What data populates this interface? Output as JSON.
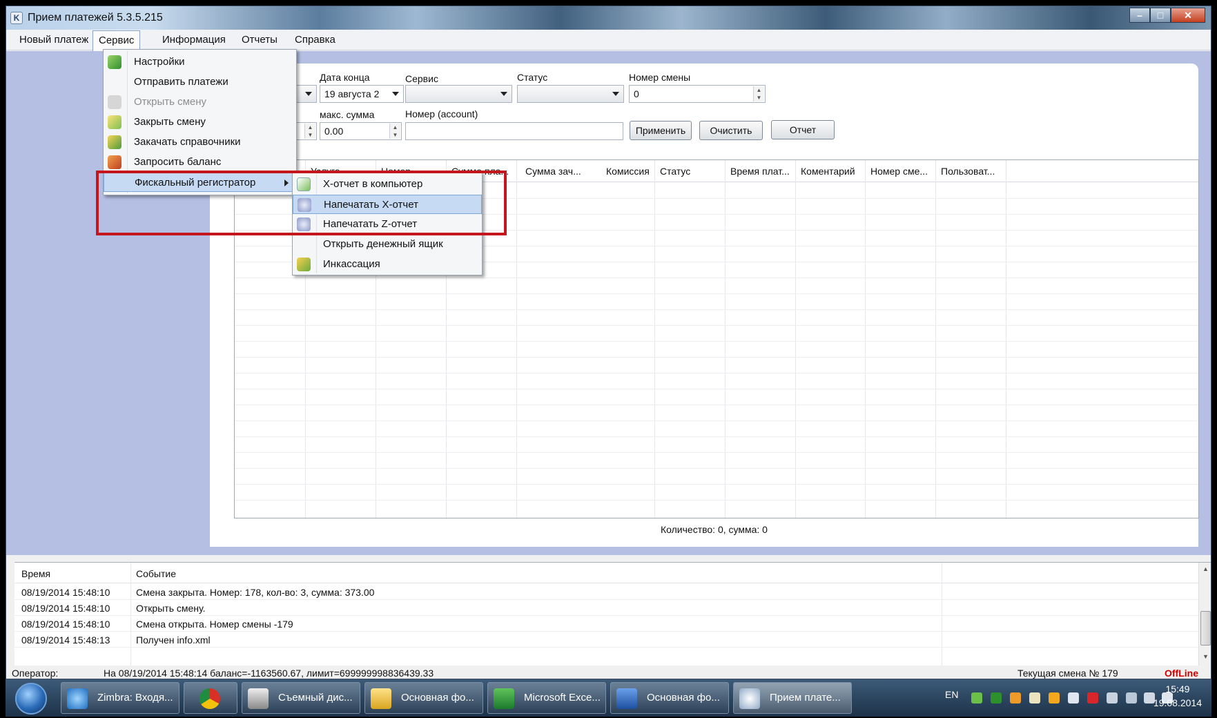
{
  "window": {
    "title": "Прием платежей 5.3.5.215",
    "controls": [
      "–",
      "□",
      "✕"
    ]
  },
  "menubar": [
    "Новый платеж",
    "Сервис",
    "Информация",
    "Отчеты",
    "Справка"
  ],
  "filters": {
    "date_end_label": "Дата конца",
    "date_end_value": "19  августа  2",
    "service_label": "Сервис",
    "status_label": "Статус",
    "shift_no_label": "Номер смены",
    "shift_no_value": "0",
    "max_sum_label": "макс. сумма",
    "max_sum_value": "0.00",
    "account_label": "Номер (account)",
    "apply_button": "Применить",
    "clear_button": "Очистить",
    "report_button": "Отчет"
  },
  "grid": {
    "columns": [
      "Услуга",
      "Номер",
      "Сумма пла...",
      "Сумма зач...",
      "Комиссия",
      "Статус",
      "Время плат...",
      "Коментарий",
      "Номер сме...",
      "Пользоват..."
    ]
  },
  "summary": "Количество: 0,  сумма: 0",
  "service_menu": {
    "items": [
      {
        "label": "Настройки",
        "icon": "settings-icon",
        "disabled": false
      },
      {
        "label": "Отправить платежи",
        "icon": "",
        "disabled": false
      },
      {
        "label": "Открыть смену",
        "icon": "open-shift-icon",
        "disabled": true
      },
      {
        "label": "Закрыть смену",
        "icon": "close-shift-icon",
        "disabled": false
      },
      {
        "label": "Закачать справочники",
        "icon": "download-icon",
        "disabled": false
      },
      {
        "label": "Запросить баланс",
        "icon": "balance-icon",
        "disabled": false
      },
      {
        "label": "Фискальный регистратор",
        "icon": "",
        "disabled": false
      }
    ]
  },
  "fiscal_submenu": {
    "items": [
      {
        "label": "Х-отчет в компьютер",
        "icon": "x-report-icon"
      },
      {
        "label": "Напечатать Х-отчет",
        "icon": "print-icon"
      },
      {
        "label": "Напечатать Z-отчет",
        "icon": "print-icon"
      },
      {
        "label": "Открыть денежный ящик",
        "icon": ""
      },
      {
        "label": "Инкассация",
        "icon": "money-icon"
      }
    ]
  },
  "log": {
    "columns": [
      "Время",
      "Событие"
    ],
    "rows": [
      {
        "time": "08/19/2014 15:48:10",
        "event": "Смена закрыта. Номер: 178, кол-во: 3, сумма: 373.00"
      },
      {
        "time": "08/19/2014 15:48:10",
        "event": "Открыть смену."
      },
      {
        "time": "08/19/2014 15:48:10",
        "event": "Смена открыта. Номер смены -179"
      },
      {
        "time": "08/19/2014 15:48:13",
        "event": "Получен info.xml"
      }
    ]
  },
  "statusbar": {
    "operator_label": "Оператор:",
    "balance_text": "На 08/19/2014 15:48:14 баланс=-1163560.67, лимит=699999998836439.33",
    "shift_text": "Текущая смена № 179",
    "mode": "OffLine"
  },
  "taskbar": {
    "tasks": [
      {
        "label": "Zimbra: Входя...",
        "icon": "ie-icon"
      },
      {
        "label": "",
        "icon": "chrome-icon"
      },
      {
        "label": "Съемный дис...",
        "icon": "drive-icon"
      },
      {
        "label": "Основная фо...",
        "icon": "folder-icon"
      },
      {
        "label": "Microsoft Exce...",
        "icon": "excel-icon"
      },
      {
        "label": "Основная фо...",
        "icon": "word-icon"
      },
      {
        "label": "Прием плате...",
        "icon": "app-icon"
      }
    ],
    "lang": "EN",
    "time": "15:49",
    "date": "19.08.2014"
  },
  "colors": {
    "desktop_bg": "#b4bfe3",
    "highlight": "#c6daf4",
    "red_box": "#c4161c",
    "offline": "#d00000"
  }
}
